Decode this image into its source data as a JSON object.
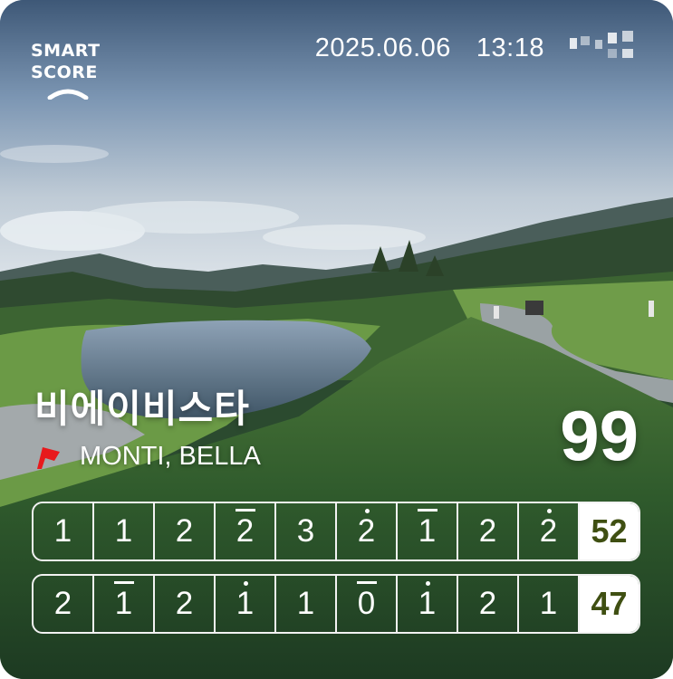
{
  "header": {
    "logo_line1": "SMART",
    "logo_line2": "SCORE",
    "date": "2025.06.06",
    "time": "13:18"
  },
  "course": {
    "name": "비에이비스타",
    "players": "MONTI, BELLA",
    "total_score": "99"
  },
  "colors": {
    "sum_bg": "#ffffff",
    "sum_text": "#3f4f12",
    "flag": "#e8191c",
    "border": "#f2f2f2"
  },
  "scorecard": {
    "front": {
      "holes": [
        {
          "score": "1",
          "mark": ""
        },
        {
          "score": "1",
          "mark": ""
        },
        {
          "score": "2",
          "mark": ""
        },
        {
          "score": "2",
          "mark": "bar"
        },
        {
          "score": "3",
          "mark": ""
        },
        {
          "score": "2",
          "mark": "dot"
        },
        {
          "score": "1",
          "mark": "bar"
        },
        {
          "score": "2",
          "mark": ""
        },
        {
          "score": "2",
          "mark": "dot"
        }
      ],
      "subtotal": "52"
    },
    "back": {
      "holes": [
        {
          "score": "2",
          "mark": ""
        },
        {
          "score": "1",
          "mark": "bar"
        },
        {
          "score": "2",
          "mark": ""
        },
        {
          "score": "1",
          "mark": "dot"
        },
        {
          "score": "1",
          "mark": ""
        },
        {
          "score": "0",
          "mark": "bar"
        },
        {
          "score": "1",
          "mark": "dot"
        },
        {
          "score": "2",
          "mark": ""
        },
        {
          "score": "1",
          "mark": ""
        }
      ],
      "subtotal": "47"
    }
  }
}
